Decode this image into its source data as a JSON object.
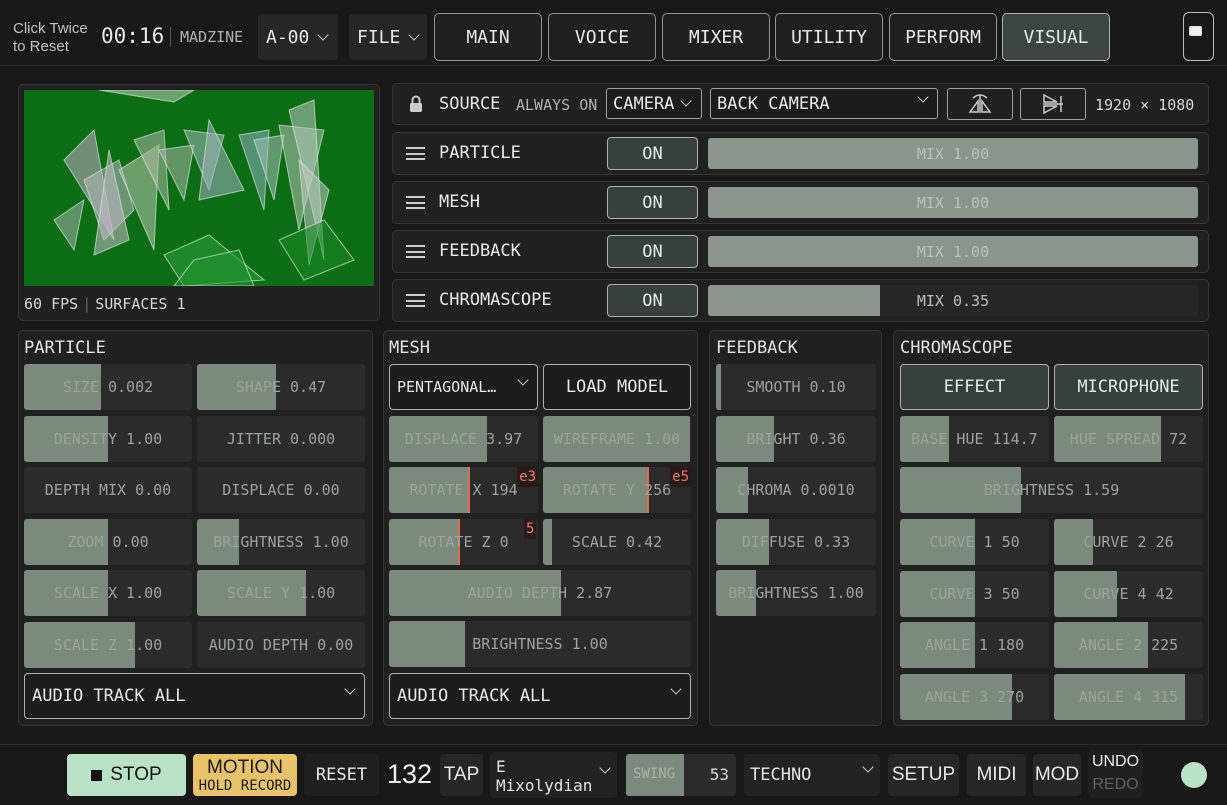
{
  "topbar": {
    "reset_hint_line1": "Click Twice",
    "reset_hint_line2": "to Reset",
    "time": "00:16",
    "device": "MADZINE",
    "preset": "A-00",
    "file_menu": "FILE",
    "tabs": [
      "MAIN",
      "VOICE",
      "MIXER",
      "UTILITY",
      "PERFORM",
      "VISUAL"
    ],
    "active_tab": "VISUAL"
  },
  "preview": {
    "fps": "60 FPS",
    "surfaces": "SURFACES 1",
    "background": "#0c6e14"
  },
  "source": {
    "label": "SOURCE",
    "mode": "ALWAYS ON",
    "type": "CAMERA",
    "device": "BACK CAMERA",
    "resolution": "1920 × 1080"
  },
  "layers": [
    {
      "name": "PARTICLE",
      "state": "ON",
      "mix_label": "MIX 1.00",
      "mix": 1.0
    },
    {
      "name": "MESH",
      "state": "ON",
      "mix_label": "MIX 1.00",
      "mix": 1.0
    },
    {
      "name": "FEEDBACK",
      "state": "ON",
      "mix_label": "MIX 1.00",
      "mix": 1.0
    },
    {
      "name": "CHROMASCOPE",
      "state": "ON",
      "mix_label": "MIX 0.35",
      "mix": 0.35
    }
  ],
  "particle": {
    "title": "PARTICLE",
    "sliders": [
      {
        "label": "SIZE 0.002",
        "fill": 0.46
      },
      {
        "label": "SHAPE 0.47",
        "fill": 0.47
      },
      {
        "label": "DENSITY 1.00",
        "fill": 0.5
      },
      {
        "label": "JITTER 0.000",
        "fill": 0
      },
      {
        "label": "DEPTH MIX 0.00",
        "fill": 0
      },
      {
        "label": "DISPLACE 0.00",
        "fill": 0
      },
      {
        "label": "ZOOM 0.00",
        "fill": 0.5
      },
      {
        "label": "BRIGHTNESS 1.00",
        "fill": 0.25
      },
      {
        "label": "SCALE X 1.00",
        "fill": 0.5
      },
      {
        "label": "SCALE Y 1.00",
        "fill": 0.65
      },
      {
        "label": "SCALE Z 1.00",
        "fill": 0.66
      },
      {
        "label": "AUDIO DEPTH 0.00",
        "fill": 0
      }
    ],
    "audio_track": "AUDIO TRACK ALL"
  },
  "mesh": {
    "title": "MESH",
    "model": "PENTAGONAL…",
    "load_model": "LOAD MODEL",
    "displace": {
      "label": "DISPLACE 3.97",
      "fill": 0.66
    },
    "wireframe": {
      "label": "WIREFRAME 1.00",
      "fill": 0.99
    },
    "rotate_x": {
      "label": "ROTATE X 194",
      "fill": 0.54,
      "badge": "e3"
    },
    "rotate_y": {
      "label": "ROTATE Y 256",
      "fill": 0.71,
      "badge": "e5"
    },
    "rotate_z": {
      "label": "ROTATE Z 0",
      "fill": 0.47,
      "badge": "5"
    },
    "scale": {
      "label": "SCALE 0.42",
      "fill": 0.06
    },
    "audio_depth": {
      "label": "AUDIO DEPTH 2.87",
      "fill": 0.57
    },
    "brightness": {
      "label": "BRIGHTNESS 1.00",
      "fill": 0.25
    },
    "audio_track": "AUDIO TRACK ALL"
  },
  "feedback": {
    "title": "FEEDBACK",
    "sliders": [
      {
        "label": "SMOOTH 0.10",
        "fill": 0.03
      },
      {
        "label": "BRIGHT 0.36",
        "fill": 0.36
      },
      {
        "label": "CHROMA 0.0010",
        "fill": 0.2
      },
      {
        "label": "DIFFUSE 0.33",
        "fill": 0.33
      },
      {
        "label": "BRIGHTNESS 1.00",
        "fill": 0.25
      }
    ]
  },
  "chromascope": {
    "title": "CHROMASCOPE",
    "effect": "EFFECT",
    "microphone": "MICROPHONE",
    "base_hue": {
      "label": "BASE HUE 114.7",
      "fill": 0.33
    },
    "hue_spread": {
      "label": "HUE SPREAD 72",
      "fill": 0.72
    },
    "brightness": {
      "label": "BRIGHTNESS 1.59",
      "fill": 0.4
    },
    "sliders": [
      {
        "label": "CURVE 1 50",
        "fill": 0.5
      },
      {
        "label": "CURVE 2 26",
        "fill": 0.26
      },
      {
        "label": "CURVE 3 50",
        "fill": 0.5
      },
      {
        "label": "CURVE 4 42",
        "fill": 0.42
      },
      {
        "label": "ANGLE 1 180",
        "fill": 0.5
      },
      {
        "label": "ANGLE 2 225",
        "fill": 0.63
      },
      {
        "label": "ANGLE 3 270",
        "fill": 0.75
      },
      {
        "label": "ANGLE 4 315",
        "fill": 0.88
      }
    ]
  },
  "bottombar": {
    "stop": "STOP",
    "motion": "MOTION",
    "hold_record": "HOLD RECORD",
    "reset": "RESET",
    "bpm": "132",
    "tap": "TAP",
    "scale_line1": "E",
    "scale_line2": "Mixolydian",
    "swing_label": "SWING",
    "swing_value": "53",
    "swing_fill": 0.53,
    "style": "TECHNO",
    "setup": "SETUP",
    "midi": "MIDI",
    "mod": "MOD",
    "undo": "UNDO",
    "redo": "REDO"
  }
}
